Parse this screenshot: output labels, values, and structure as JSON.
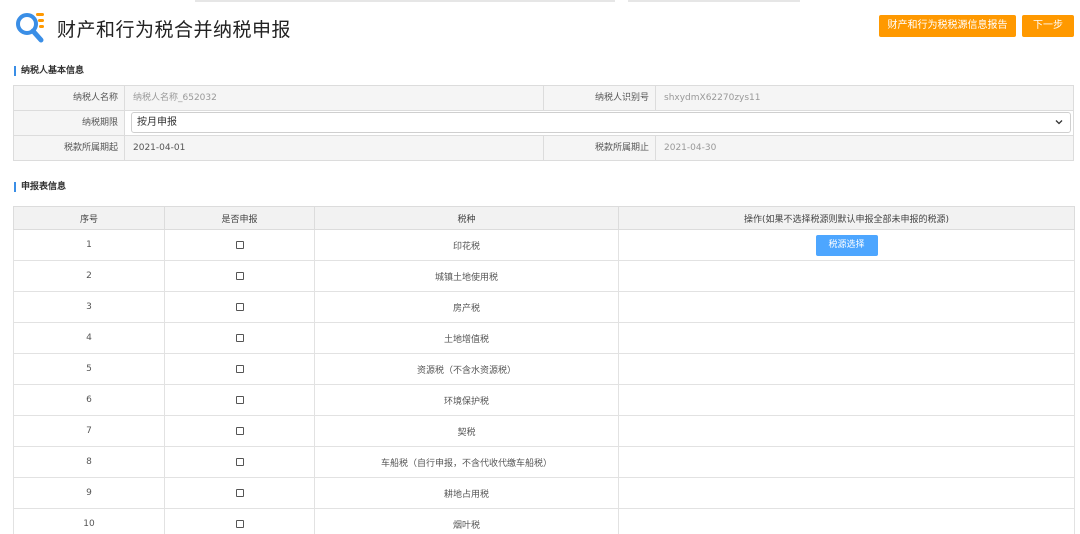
{
  "header": {
    "title": "财产和行为税合并纳税申报",
    "report_button": "财产和行为税税源信息报告",
    "next_button": "下一步"
  },
  "taxpayer_section": {
    "title": "纳税人基本信息",
    "name_label": "纳税人名称",
    "name_value": "纳税人名称_652032",
    "id_label": "纳税人识别号",
    "id_value": "shxydmX62270zys11",
    "period_label": "纳税期限",
    "period_value": "按月申报",
    "start_label": "税款所属期起",
    "start_value": "2021-04-01",
    "end_label": "税款所属期止",
    "end_value": "2021-04-30"
  },
  "declaration_section": {
    "title": "申报表信息",
    "columns": [
      "序号",
      "是否申报",
      "税种",
      "操作(如果不选择税源则默认申报全部未申报的税源)"
    ],
    "source_button": "税源选择",
    "rows": [
      {
        "no": "1",
        "tax": "印花税",
        "declared": false
      },
      {
        "no": "2",
        "tax": "城镇土地使用税",
        "declared": false
      },
      {
        "no": "3",
        "tax": "房产税",
        "declared": false
      },
      {
        "no": "4",
        "tax": "土地增值税",
        "declared": false
      },
      {
        "no": "5",
        "tax": "资源税（不含水资源税）",
        "declared": false
      },
      {
        "no": "6",
        "tax": "环境保护税",
        "declared": false
      },
      {
        "no": "7",
        "tax": "契税",
        "declared": false
      },
      {
        "no": "8",
        "tax": "车船税（自行申报，不含代收代缴车船税）",
        "declared": false
      },
      {
        "no": "9",
        "tax": "耕地占用税",
        "declared": false
      },
      {
        "no": "10",
        "tax": "烟叶税",
        "declared": false
      }
    ]
  },
  "colors": {
    "accent_orange": "#ff9900",
    "button_blue": "#4da6ff",
    "section_marker": "#3a8ee6"
  },
  "icons": [
    "search-list-logo-icon",
    "chevron-down-icon"
  ]
}
